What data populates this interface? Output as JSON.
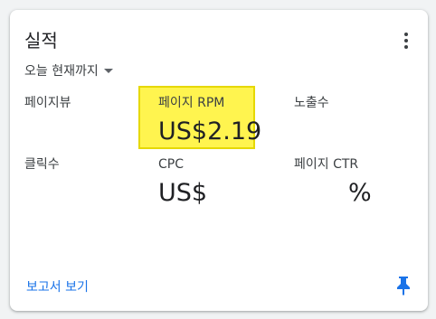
{
  "card": {
    "title": "실적",
    "date_range": "오늘 현재까지",
    "metrics": [
      {
        "label": "페이지뷰",
        "value": ""
      },
      {
        "label": "페이지 RPM",
        "value": "US$2.19"
      },
      {
        "label": "노출수",
        "value": ""
      },
      {
        "label": "클릭수",
        "value": ""
      },
      {
        "label": "CPC",
        "value": "US$"
      },
      {
        "label": "페이지 CTR",
        "value": "%"
      }
    ],
    "footer_link": "보고서 보기",
    "icons": {
      "more": "more-vert-icon",
      "dropdown": "caret-down-icon",
      "pin": "pin-icon"
    }
  },
  "colors": {
    "highlight": "#fff44f",
    "link": "#1a73e8",
    "pin": "#1a73e8"
  }
}
